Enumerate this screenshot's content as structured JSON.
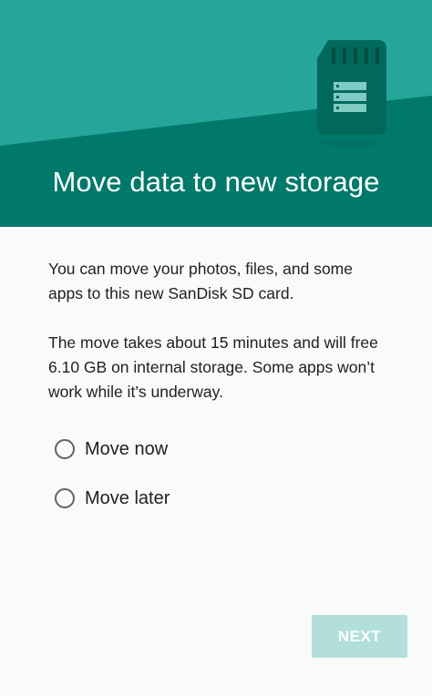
{
  "header": {
    "title": "Move data to new storage",
    "colors": {
      "light_band": "#26a69a",
      "dark_band": "#00796b",
      "card": "#00695c",
      "card_stripes": "#80cbc4"
    },
    "illustration_icon": "sd-card-icon"
  },
  "body": {
    "paragraph_1": "You can move your photos, files, and some apps to this new SanDisk SD card.",
    "paragraph_2": "The move takes about 15 minutes and will free 6.10 GB on internal storage. Some apps won’t work while it’s underway."
  },
  "options": {
    "move_now": "Move now",
    "move_later": "Move later",
    "selected": null
  },
  "actions": {
    "next_label": "NEXT",
    "next_enabled": false,
    "accent_color": "#b2dfdb"
  }
}
